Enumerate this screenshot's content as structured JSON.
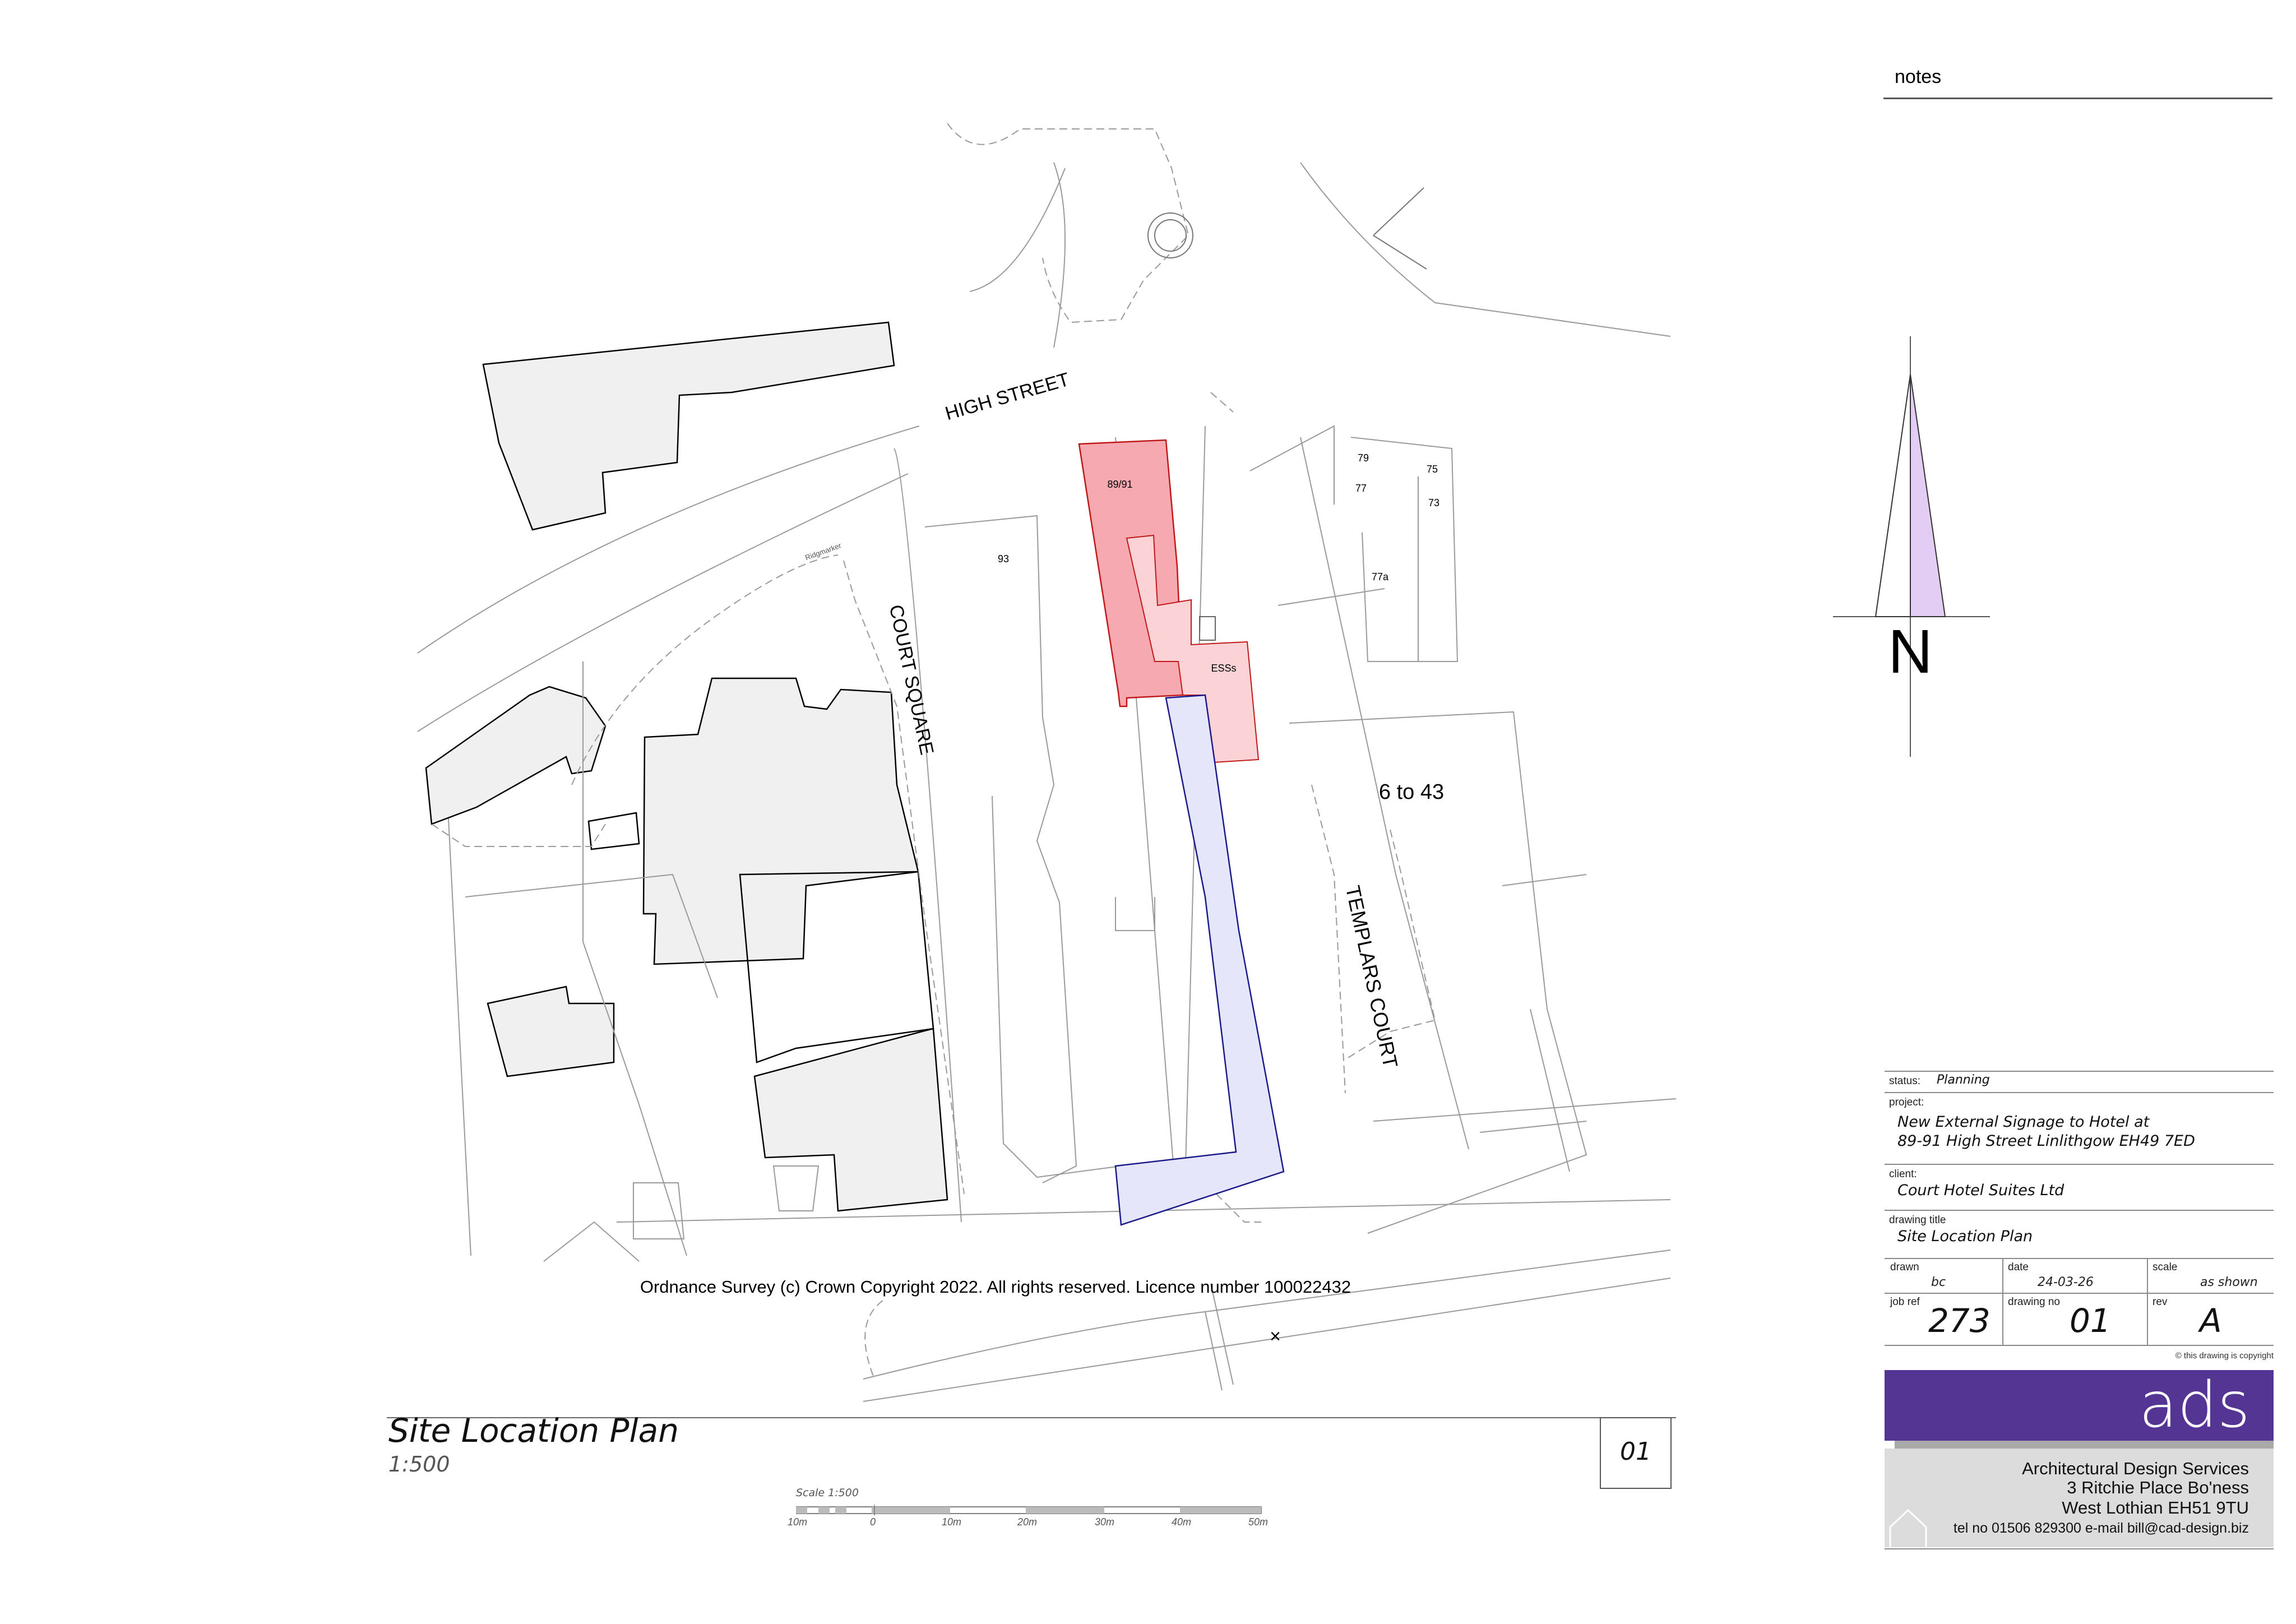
{
  "notes_label": "notes",
  "map": {
    "street_high": "HIGH STREET",
    "street_court_square": "COURT SQUARE",
    "street_templars_court": "TEMPLARS COURT",
    "label_8991": "89/91",
    "label_93": "93",
    "label_79": "79",
    "label_77": "77",
    "label_75": "75",
    "label_73": "73",
    "label_77a": "77a",
    "label_ess": "ESSs",
    "label_6to43": "6 to 43",
    "label_rigymarker": "Ridgmarker",
    "copyright": "Ordnance Survey (c) Crown Copyright 2022. All rights reserved. Licence number 100022432"
  },
  "north_arrow": {
    "letter": "N"
  },
  "drawing_title_block": {
    "title": "Site Location Plan",
    "scale": "1:500",
    "sheet": "01"
  },
  "scale_bar": {
    "caption": "Scale 1:500",
    "ticks": [
      "10m",
      "0",
      "10m",
      "20m",
      "30m",
      "40m",
      "50m"
    ]
  },
  "title_block": {
    "status_label": "status:",
    "status_value": "Planning",
    "project_label": "project:",
    "project_line1": "New External Signage to Hotel at",
    "project_line2": "89-91 High Street Linlithgow EH49 7ED",
    "client_label": "client:",
    "client_value": "Court Hotel Suites Ltd",
    "drawing_title_label": "drawing title",
    "drawing_title_value": "Site Location Plan",
    "drawn_label": "drawn",
    "drawn_value": "bc",
    "date_label": "date",
    "date_value": "24-03-26",
    "scale_label": "scale",
    "scale_value": "as shown",
    "job_ref_label": "job ref",
    "job_ref_value": "273",
    "drawing_no_label": "drawing no",
    "drawing_no_value": "01",
    "rev_label": "rev",
    "rev_value": "A",
    "copyright_note": "© this drawing is copyright"
  },
  "company": {
    "logo": "ads",
    "name": "Architectural Design Services",
    "address1": "3 Ritchie Place Bo'ness",
    "address2": "West Lothian EH51 9TU",
    "contact": "tel no 01506 829300 e-mail bill@cad-design.biz",
    "brand_color": "#553594",
    "band_color": "#a9a9a9",
    "panel_color": "#dcdcdc"
  },
  "colors": {
    "site_red": "#f7a9b2",
    "site_pink": "#fbd3d6",
    "access_blue": "#e6e6fa",
    "building_grey": "#f0f0f0",
    "north_fill": "#e3cdf5"
  }
}
